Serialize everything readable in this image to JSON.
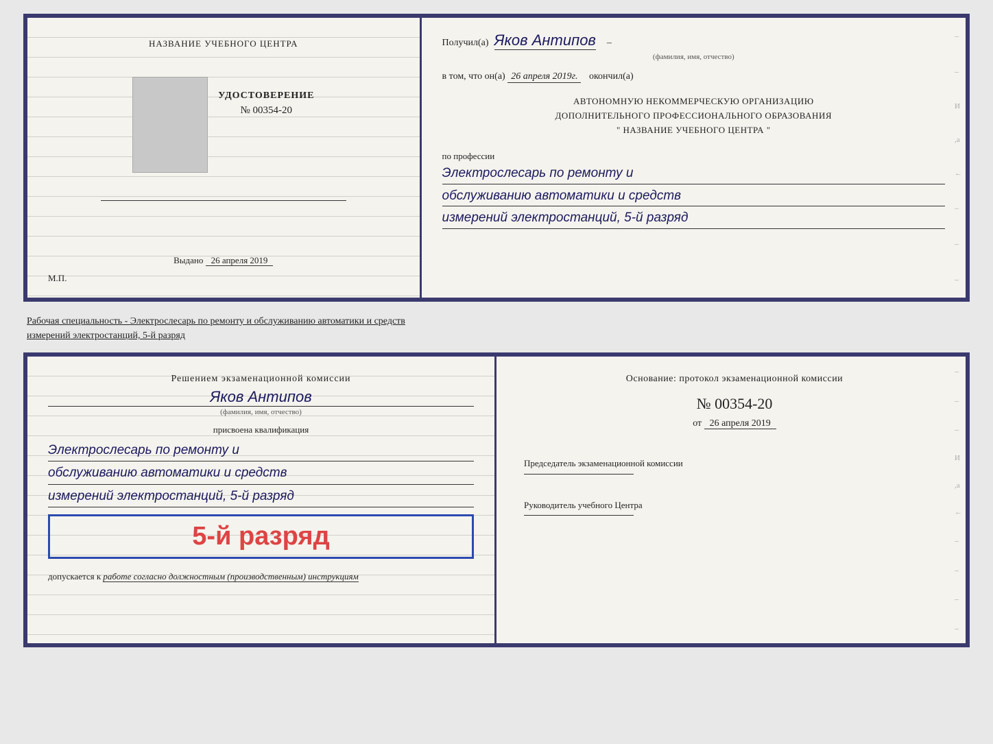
{
  "top_cert": {
    "left": {
      "org_name": "НАЗВАНИЕ УЧЕБНОГО ЦЕНТРА",
      "title": "УДОСТОВЕРЕНИЕ",
      "number": "№ 00354-20",
      "issued_label": "Выдано",
      "issued_date": "26 апреля 2019",
      "mp": "М.П."
    },
    "right": {
      "poluchil_prefix": "Получил(а)",
      "recipient_name": "Яков Антипов",
      "fio_label": "(фамилия, имя, отчество)",
      "vtom_prefix": "в том, что он(а)",
      "completed_date": "26 апреля 2019г.",
      "okончил": "окончил(а)",
      "org_line1": "АВТОНОМНУЮ НЕКОММЕРЧЕСКУЮ ОРГАНИЗАЦИЮ",
      "org_line2": "ДОПОЛНИТЕЛЬНОГО ПРОФЕССИОНАЛЬНОГО ОБРАЗОВАНИЯ",
      "org_line3": "\"  НАЗВАНИЕ УЧЕБНОГО ЦЕНТРА  \"",
      "po_professii": "по профессии",
      "profession_line1": "Электрослесарь по ремонту и",
      "profession_line2": "обслуживанию автоматики и средств",
      "profession_line3": "измерений электростанций, 5-й разряд"
    }
  },
  "specialty_text": {
    "prefix": "Рабочая специальность - ",
    "main": "Электрослесарь по ремонту и обслуживанию автоматики и средств",
    "line2": "измерений электростанций, 5-й разряд"
  },
  "bottom_cert": {
    "left": {
      "decision": "Решением экзаменационной комиссии",
      "assignee_name": "Яков Антипов",
      "fio_label": "(фамилия, имя, отчество)",
      "prisvoena": "присвоена квалификация",
      "qual_line1": "Электрослесарь по ремонту и",
      "qual_line2": "обслуживанию автоматики и средств",
      "qual_line3": "измерений электростанций, 5-й разряд",
      "razryad_label": "5-й разряд",
      "dopuskaetsya_prefix": "допускается к",
      "dopuskaetsya_text": "работе согласно должностным (производственным) инструкциям"
    },
    "right": {
      "osnovanie": "Основание: протокол экзаменационной  комиссии",
      "protocol_num": "№  00354-20",
      "ot_label": "от",
      "ot_date": "26 апреля 2019",
      "chairman_title": "Председатель экзаменационной комиссии",
      "head_title": "Руководитель учебного Центра"
    }
  }
}
